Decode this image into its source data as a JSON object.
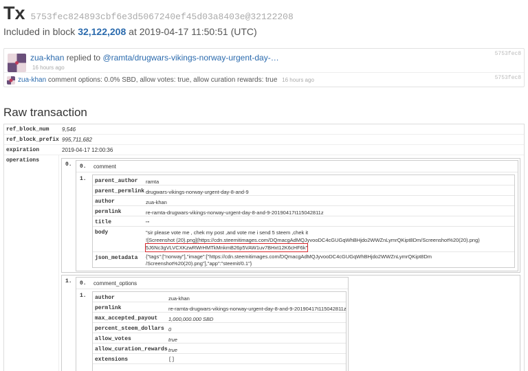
{
  "header": {
    "title": "Tx",
    "hash": "5753fec824893cbf6e3d5067240ef45d03a8403e@32122208",
    "included_prefix": "Included in block",
    "block_number": "32,122,208",
    "included_suffix": "at 2019-04-17 11:50:51 (UTC)"
  },
  "operations_feed": [
    {
      "author": "zua-khan",
      "verb": "replied to",
      "target": "@ramta/drugwars-vikings-norway-urgent-day-…",
      "ago": "16 hours ago",
      "id": "5753fec8"
    },
    {
      "author": "zua-khan",
      "text": "comment options: 0.0% SBD, allow votes: true, allow curation rewards: true",
      "ago": "16 hours ago",
      "id": "5753fec8"
    }
  ],
  "raw": {
    "title": "Raw transaction",
    "ref_block_num": {
      "key": "ref_block_num",
      "value": "9,546"
    },
    "ref_block_prefix": {
      "key": "ref_block_prefix",
      "value": "995,711,682"
    },
    "expiration": {
      "key": "expiration",
      "value": "2019-04-17 12:00:36"
    },
    "operations_key": "operations",
    "op0": {
      "index": "0.",
      "type_index": "0.",
      "type": "comment",
      "body_index": "1.",
      "fields": {
        "parent_author": {
          "key": "parent_author",
          "value": "ramta"
        },
        "parent_permlink": {
          "key": "parent_permlink",
          "value": "drugwars-vikings-norway-urgent-day-8-and-9"
        },
        "author": {
          "key": "author",
          "value": "zua-khan"
        },
        "permlink": {
          "key": "permlink",
          "value": "re-ramta-drugwars-vikings-norway-urgent-day-8-and-9-20190417t115042811z"
        },
        "title": {
          "key": "title",
          "value": "\"\""
        },
        "body": {
          "key": "body",
          "line1": "\"sir please vote me , chek my post ,and vote me i send 5 steem ,chek it",
          "line2": "![Screenshot (20).png](https://cdn.steemitimages.com/DQmacgAdMQJyvooDC4cGUGqWhBHjdo2WWZnLymrQKipt8Dm/Screenshot%20(20).png)",
          "line3": "5J6Nc3gVLVCXKzwRWrHMTkMnkmB26p5VAW1uv7BHxt12K6cHF6k\""
        },
        "json_metadata": {
          "key": "json_metadata",
          "line1": "{\"tags\":[\"norway\"],\"image\":[\"https://cdn.steemitimages.com/DQmacgAdMQJyvooDC4cGUGqWhBHjdo2WWZnLymrQKipt8Dm",
          "line2": "/Screenshot%20(20).png\"],\"app\":\"steemit/0.1\"}"
        }
      }
    },
    "op1": {
      "index": "1.",
      "type_index": "0.",
      "type": "comment_options",
      "body_index": "1.",
      "fields": {
        "author": {
          "key": "author",
          "value": "zua-khan"
        },
        "permlink": {
          "key": "permlink",
          "value": "re-ramta-drugwars-vikings-norway-urgent-day-8-and-9-20190417t115042811z"
        },
        "max_accepted_payout": {
          "key": "max_accepted_payout",
          "value": "1,000,000.000 SBD"
        },
        "percent_steem_dollars": {
          "key": "percent_steem_dollars",
          "value": "0"
        },
        "allow_votes": {
          "key": "allow_votes",
          "value": "true"
        },
        "allow_curation_rewards": {
          "key": "allow_curation_rewards",
          "value": "true"
        },
        "extensions": {
          "key": "extensions",
          "value": "[]"
        }
      }
    }
  },
  "colors": {
    "link": "#2a6aad",
    "green_value": "#1b9a1b",
    "highlight": "#d9252a"
  }
}
